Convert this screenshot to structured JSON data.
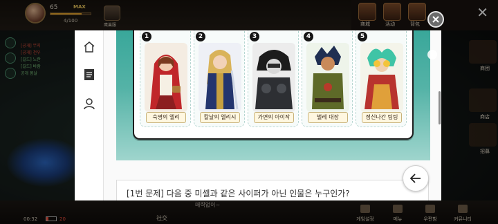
{
  "hud": {
    "level": "65",
    "level_badge": "MAX",
    "stamina": "4/100",
    "exp_fraction": 0.78,
    "pet_label": "鹰巢服"
  },
  "chat": {
    "lines": [
      "[공개] 무지",
      "[공개] 천우",
      "[길드] 노란",
      "[길드] 바람",
      "공개 봄날"
    ]
  },
  "top_menu": {
    "items": [
      {
        "label": "商城",
        "icon": "shop-icon"
      },
      {
        "label": "活动",
        "icon": "event-icon"
      },
      {
        "label": "背包",
        "icon": "bag-icon"
      }
    ]
  },
  "right_menu": {
    "items": [
      "商团",
      "商店",
      "招募"
    ]
  },
  "bottom": {
    "time": "00:32",
    "battery_percent": 20,
    "battery_label": "20",
    "social_label": "社交",
    "whisper": "매력없이~",
    "nav": [
      "게임설정",
      "메뉴",
      "우편함",
      "커뮤니티"
    ]
  },
  "sidenav": {
    "items": [
      "home",
      "list",
      "profile"
    ]
  },
  "quiz": {
    "cards": [
      {
        "number": "1",
        "name": "숙명의 엘리"
      },
      {
        "number": "2",
        "name": "칼날의 엘리시"
      },
      {
        "number": "3",
        "name": "가면의 아이작"
      },
      {
        "number": "4",
        "name": "벌레 대장"
      },
      {
        "number": "5",
        "name": "정신나간 팅팅"
      }
    ],
    "question": "[1번 문제] 다음 중 미셸과 같은 사이퍼가 아닌 인물은 누구인가?"
  },
  "colors": {
    "banner_top": "#39a79a",
    "banner_bottom": "#9fd5cd",
    "close_button": "#6b6b6b"
  }
}
